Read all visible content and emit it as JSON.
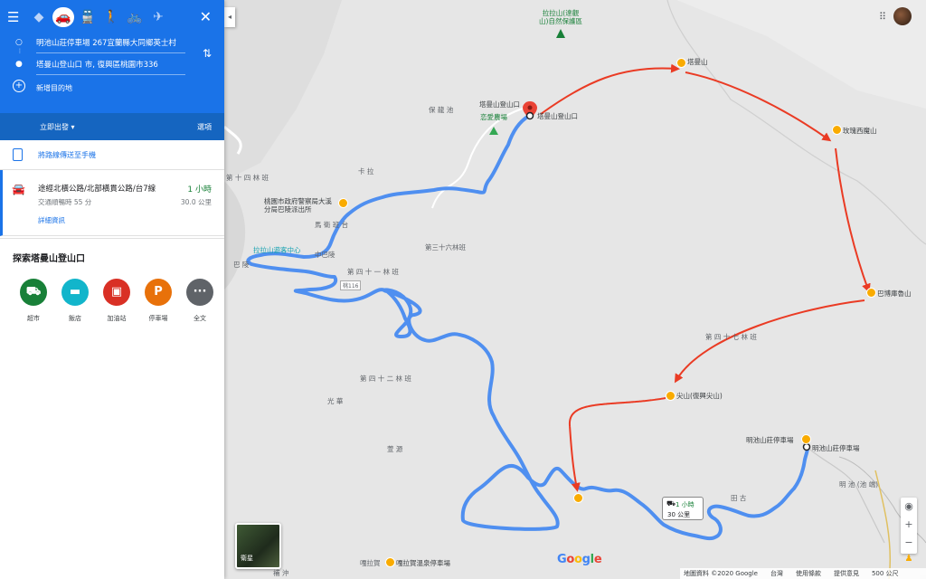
{
  "header": {
    "origin": "明池山莊停車場 267宜蘭縣大同鄉英士村",
    "destination": "塔曼山登山口 市, 復興區桃園市336",
    "add_destination": "新增目的地",
    "depart_now": "立即出發",
    "options": "選項"
  },
  "send_to_phone": "將路線傳送至手機",
  "route": {
    "name": "途經北橫公路/北部橫貫公路/台7線",
    "time": "1 小時",
    "traffic_note": "交通順暢時 55 分",
    "distance": "30.0 公里",
    "details": "詳細資訊"
  },
  "explore": {
    "title": "探索塔曼山登山口",
    "items": [
      {
        "label": "超市",
        "color": "#188038",
        "icon": "cart-icon",
        "glyph": "🛒"
      },
      {
        "label": "飯店",
        "color": "#12b5cb",
        "icon": "hotel-icon",
        "glyph": "▬"
      },
      {
        "label": "加油站",
        "color": "#d93025",
        "icon": "gas-icon",
        "glyph": "⛽"
      },
      {
        "label": "停車場",
        "color": "#e8710a",
        "icon": "parking-icon",
        "glyph": "P"
      },
      {
        "label": "全文",
        "color": "#5f6368",
        "icon": "more-icon",
        "glyph": "···"
      }
    ]
  },
  "map": {
    "peaks": {
      "taman": "塔曼山",
      "meigui": "玫瑰西魔山",
      "babo": "巴博庫魯山",
      "jianshan": "尖山(復興尖山)",
      "mingchi": "明池山莊停車場"
    },
    "labels": {
      "lala_reserve": "拉拉山(達觀山)自然保護區",
      "trailhead": "塔曼山登山口",
      "trailhead_poi": "塔曼山登山口",
      "farm": "恋愛農場",
      "baolun": "保 龍 池",
      "kala": "卡 拉",
      "forest14": "第 十 四 林 班",
      "forest36": "第三十六林班",
      "forest41": "第 四 十 一 林 班",
      "forest42": "第 四 十 二 林 班",
      "forest47": "第 四 十 七 林 班",
      "police": "桃園市政府警察局大溪分局巴陵派出所",
      "visitor_center": "拉拉山遊客中心",
      "mahang": "馬 衛 班 台",
      "zhongbaling": "中巴陵",
      "baling": "巴 陵",
      "guanghua": "光 華",
      "xiuyuan": "萱 源",
      "gala_parking": "嘎拉賀溫泉停車場",
      "galahe": "嘎拉賀",
      "buchong": "補 沖",
      "mingchi_place": "明 池 (池 端)",
      "tian": "田 古",
      "road116": "桃116",
      "mingchi_poi": "明池山莊停車場"
    },
    "callout": {
      "time": "1 小時",
      "distance": "30 公里"
    },
    "satellite": "衛星",
    "attribution": [
      "地圖資料 ©2020 Google",
      "台灣",
      "使用條款",
      "提供意見",
      "500 公尺"
    ]
  },
  "colors": {
    "accent": "#1a73e8",
    "route": "#4f8ff0",
    "arrow": "#ea3b24",
    "pin": "#f9ab00"
  }
}
